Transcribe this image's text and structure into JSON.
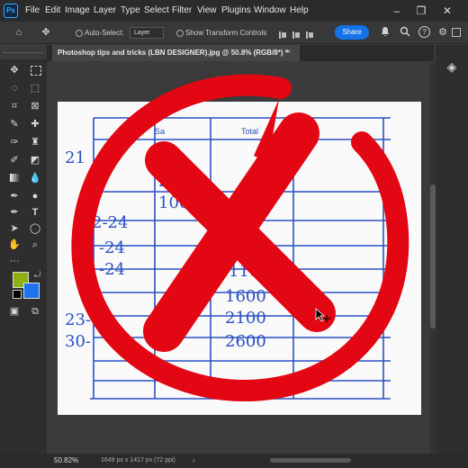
{
  "app": {
    "logo": "Ps"
  },
  "menu": [
    "File",
    "Edit",
    "Image",
    "Layer",
    "Type",
    "Select",
    "Filter",
    "View",
    "Plugins",
    "Window",
    "Help"
  ],
  "window_controls": {
    "minimize": "–",
    "restore": "❐",
    "close": "✕"
  },
  "options": {
    "auto_select_label": "Auto-Select:",
    "layer_value": "Layer",
    "show_transform_label": "Show Transform Controls",
    "share_label": "Share"
  },
  "document": {
    "tab_title": "Photoshop tips and tricks (LBN DESIGNER).jpg @ 50.8% (RGB/8*) *",
    "close_glyph": "×",
    "headers": {
      "sales": "Sa",
      "total": "Total"
    },
    "left_column": [
      "21",
      "",
      "2",
      "2-24",
      "",
      "-24",
      "-24",
      "",
      "23-",
      "30-"
    ],
    "values": [
      "2",
      "200",
      "100",
      "",
      "",
      "1000",
      "1100",
      "1600",
      "2100",
      "2600"
    ]
  },
  "status": {
    "zoom": "50.82%",
    "info": "1649 px x 1417 px (72 ppi)"
  },
  "colors": {
    "foreground": "#8db012",
    "background": "#1e73f0",
    "x_mark": "#e30613",
    "ink": "#2a4fc4",
    "accent": "#1473e6"
  },
  "icons": {
    "home": "⌂",
    "move": "✥",
    "search": "⌕",
    "help": "?",
    "gear": "⚙",
    "bell": "🔔",
    "layers": "◈"
  }
}
